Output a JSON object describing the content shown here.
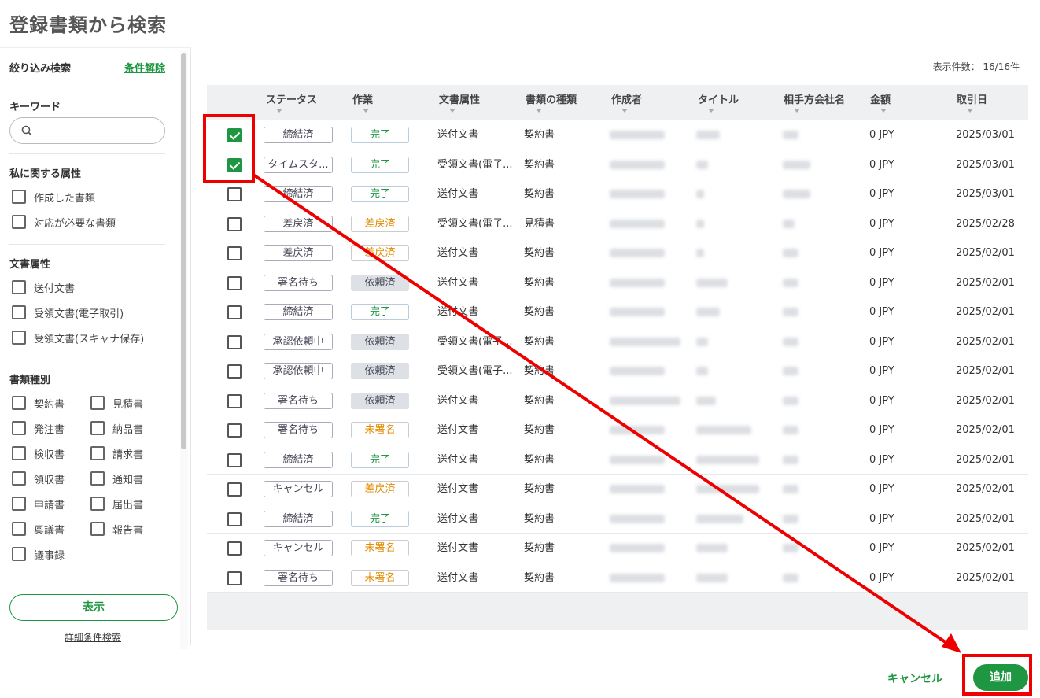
{
  "page": {
    "title": "登録書類から検索"
  },
  "sidebar": {
    "filter_title": "絞り込み検索",
    "clear_label": "条件解除",
    "keyword": {
      "title": "キーワード",
      "value": "",
      "placeholder": ""
    },
    "personal": {
      "title": "私に関する属性",
      "options": [
        "作成した書類",
        "対応が必要な書類"
      ]
    },
    "doc_attr": {
      "title": "文書属性",
      "options": [
        "送付文書",
        "受領文書(電子取引)",
        "受領文書(スキャナ保存)"
      ]
    },
    "doc_type": {
      "title": "書類種別",
      "options": [
        "契約書",
        "見積書",
        "発注書",
        "納品書",
        "検収書",
        "請求書",
        "領収書",
        "通知書",
        "申請書",
        "届出書",
        "稟議書",
        "報告書",
        "議事録"
      ]
    },
    "show_label": "表示",
    "advanced_label": "詳細条件検索"
  },
  "main": {
    "count_text": "表示件数： 16/16件",
    "columns": [
      "ステータス",
      "作業",
      "文書属性",
      "書類の種類",
      "作成者",
      "タイトル",
      "相手方会社名",
      "金額",
      "取引日"
    ],
    "rows": [
      {
        "checked": true,
        "status": "締結済",
        "work": "完了",
        "work_color": "green",
        "attr": "送付文書",
        "type": "契約書",
        "amount": "0 JPY",
        "date": "2025/03/01"
      },
      {
        "checked": true,
        "status": "タイムスタ...",
        "work": "完了",
        "work_color": "green",
        "attr": "受領文書(電子...",
        "type": "契約書",
        "amount": "0 JPY",
        "date": "2025/03/01"
      },
      {
        "checked": false,
        "status": "締結済",
        "work": "完了",
        "work_color": "green",
        "attr": "送付文書",
        "type": "契約書",
        "amount": "0 JPY",
        "date": "2025/03/01"
      },
      {
        "checked": false,
        "status": "差戻済",
        "work": "差戻済",
        "work_color": "orange",
        "attr": "受領文書(電子...",
        "type": "見積書",
        "amount": "0 JPY",
        "date": "2025/02/28"
      },
      {
        "checked": false,
        "status": "差戻済",
        "work": "差戻済",
        "work_color": "orange",
        "attr": "送付文書",
        "type": "契約書",
        "amount": "0 JPY",
        "date": "2025/02/01"
      },
      {
        "checked": false,
        "status": "署名待ち",
        "work": "依頼済",
        "work_color": "gray",
        "attr": "送付文書",
        "type": "契約書",
        "amount": "0 JPY",
        "date": "2025/02/01"
      },
      {
        "checked": false,
        "status": "締結済",
        "work": "完了",
        "work_color": "green",
        "attr": "送付文書",
        "type": "契約書",
        "amount": "0 JPY",
        "date": "2025/02/01"
      },
      {
        "checked": false,
        "status": "承認依頼中",
        "work": "依頼済",
        "work_color": "gray",
        "attr": "受領文書(電子...",
        "type": "契約書",
        "amount": "0 JPY",
        "date": "2025/02/01"
      },
      {
        "checked": false,
        "status": "承認依頼中",
        "work": "依頼済",
        "work_color": "gray",
        "attr": "受領文書(電子...",
        "type": "契約書",
        "amount": "0 JPY",
        "date": "2025/02/01"
      },
      {
        "checked": false,
        "status": "署名待ち",
        "work": "依頼済",
        "work_color": "gray",
        "attr": "送付文書",
        "type": "契約書",
        "amount": "0 JPY",
        "date": "2025/02/01"
      },
      {
        "checked": false,
        "status": "署名待ち",
        "work": "未署名",
        "work_color": "orange",
        "attr": "送付文書",
        "type": "契約書",
        "amount": "0 JPY",
        "date": "2025/02/01"
      },
      {
        "checked": false,
        "status": "締結済",
        "work": "完了",
        "work_color": "green",
        "attr": "送付文書",
        "type": "契約書",
        "amount": "0 JPY",
        "date": "2025/02/01"
      },
      {
        "checked": false,
        "status": "キャンセル",
        "work": "差戻済",
        "work_color": "orange",
        "attr": "送付文書",
        "type": "契約書",
        "amount": "0 JPY",
        "date": "2025/02/01"
      },
      {
        "checked": false,
        "status": "締結済",
        "work": "完了",
        "work_color": "green",
        "attr": "送付文書",
        "type": "契約書",
        "amount": "0 JPY",
        "date": "2025/02/01"
      },
      {
        "checked": false,
        "status": "キャンセル",
        "work": "未署名",
        "work_color": "orange",
        "attr": "送付文書",
        "type": "契約書",
        "amount": "0 JPY",
        "date": "2025/02/01"
      },
      {
        "checked": false,
        "status": "署名待ち",
        "work": "未署名",
        "work_color": "orange",
        "attr": "送付文書",
        "type": "契約書",
        "amount": "0 JPY",
        "date": "2025/02/01"
      }
    ]
  },
  "footer": {
    "cancel_label": "キャンセル",
    "add_label": "追加"
  },
  "colors": {
    "accent": "#1e9642",
    "warning": "#e08a00",
    "annotation": "#e00000"
  }
}
